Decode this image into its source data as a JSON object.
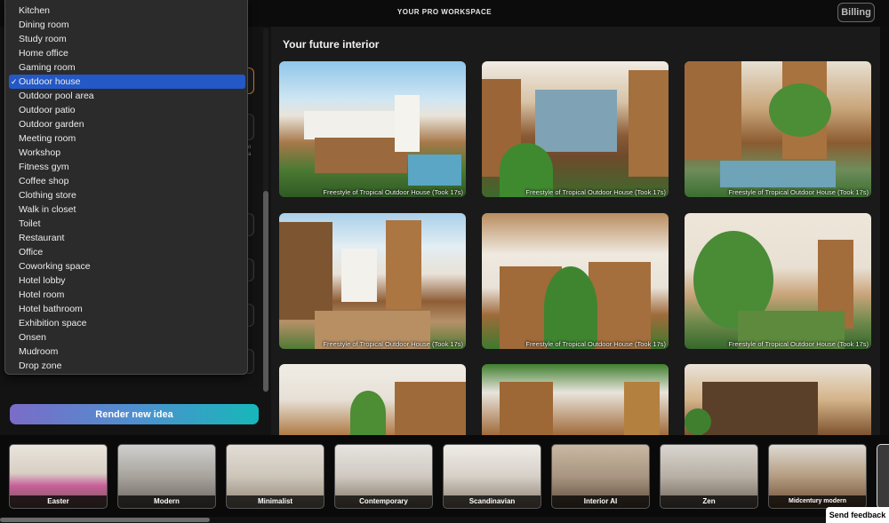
{
  "header": {
    "workspace_title": "YOUR PRO WORKSPACE",
    "billing_label": "Billing"
  },
  "room_dropdown": {
    "selected": "Outdoor house",
    "options": [
      "Kitchen",
      "Dining room",
      "Study room",
      "Home office",
      "Gaming room",
      "Outdoor house",
      "Outdoor pool area",
      "Outdoor patio",
      "Outdoor garden",
      "Meeting room",
      "Workshop",
      "Fitness gym",
      "Coffee shop",
      "Clothing store",
      "Walk in closet",
      "Toilet",
      "Restaurant",
      "Office",
      "Coworking space",
      "Hotel lobby",
      "Hotel room",
      "Hotel bathroom",
      "Exhibition space",
      "Onsen",
      "Mudroom",
      "Drop zone"
    ],
    "check_mark": "✓"
  },
  "render_button": {
    "label": "Render new idea"
  },
  "results": {
    "title": "Your future interior",
    "items": [
      {
        "caption": "Freestyle of Tropical Outdoor House (Took 17s)"
      },
      {
        "caption": "Freestyle of Tropical Outdoor House (Took 17s)"
      },
      {
        "caption": "Freestyle of Tropical Outdoor House (Took 17s)"
      },
      {
        "caption": "Freestyle of Tropical Outdoor House (Took 17s)"
      },
      {
        "caption": "Freestyle of Tropical Outdoor House (Took 17s)"
      },
      {
        "caption": "Freestyle of Tropical Outdoor House (Took 17s)"
      },
      {
        "caption": ""
      },
      {
        "caption": ""
      },
      {
        "caption": ""
      }
    ]
  },
  "styles": {
    "items": [
      {
        "label": "Easter"
      },
      {
        "label": "Modern"
      },
      {
        "label": "Minimalist"
      },
      {
        "label": "Contemporary"
      },
      {
        "label": "Scandinavian"
      },
      {
        "label": "Interior AI"
      },
      {
        "label": "Zen"
      },
      {
        "label": "Midcentury modern"
      }
    ]
  },
  "feedback_button": {
    "label": "Send feedback"
  },
  "colors": {
    "selected_option": "#2358c6",
    "render_gradient_start": "#7a6cc7",
    "render_gradient_end": "#17b7b9",
    "accent_orange": "#d07a2a"
  }
}
